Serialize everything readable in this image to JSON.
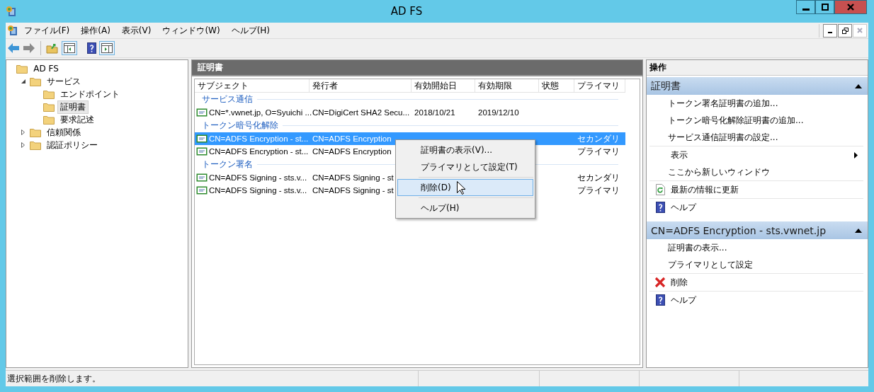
{
  "window": {
    "title": "AD FS"
  },
  "menu": [
    {
      "label": "ファイル(F)"
    },
    {
      "label": "操作(A)"
    },
    {
      "label": "表示(V)"
    },
    {
      "label": "ウィンドウ(W)"
    },
    {
      "label": "ヘルプ(H)"
    }
  ],
  "tree": [
    {
      "label": "AD FS",
      "selected": false,
      "children": [
        {
          "label": "サービス",
          "selected": false,
          "expanded": true,
          "children": [
            {
              "label": "エンドポイント",
              "selected": false
            },
            {
              "label": "証明書",
              "selected": true
            },
            {
              "label": "要求記述",
              "selected": false
            }
          ]
        },
        {
          "label": "信頼関係",
          "selected": false,
          "expanded": false
        },
        {
          "label": "認証ポリシー",
          "selected": false,
          "expanded": false
        }
      ]
    }
  ],
  "list": {
    "title": "証明書",
    "columns": [
      "サブジェクト",
      "発行者",
      "有効開始日",
      "有効期限",
      "状態",
      "プライマリ"
    ],
    "groups": [
      {
        "label": "サービス通信",
        "rows": [
          {
            "subject": "CN=*.vwnet.jp, O=Syuichi ...",
            "issuer": "CN=DigiCert SHA2 Secu...",
            "valid_from": "2018/10/21",
            "valid_to": "2019/12/10",
            "selected": false
          }
        ]
      },
      {
        "label": "トークン暗号化解除",
        "rows": [
          {
            "subject": "CN=ADFS Encryption - st...",
            "issuer": "CN=ADFS Encryption",
            "primary": "セカンダリ",
            "selected": true
          },
          {
            "subject": "CN=ADFS Encryption - st...",
            "issuer": "CN=ADFS Encryption",
            "primary": "プライマリ",
            "selected": false
          }
        ]
      },
      {
        "label": "トークン署名",
        "rows": [
          {
            "subject": "CN=ADFS Signing - sts.v...",
            "issuer": "CN=ADFS Signing - st",
            "primary": "セカンダリ",
            "selected": false
          },
          {
            "subject": "CN=ADFS Signing - sts.v...",
            "issuer": "CN=ADFS Signing - st",
            "primary": "プライマリ",
            "selected": false
          }
        ]
      }
    ]
  },
  "context_menu": {
    "items": [
      {
        "kind": "item",
        "label": "証明書の表示(V)...",
        "selected": false
      },
      {
        "kind": "item",
        "label": "プライマリとして設定(T)",
        "selected": false
      },
      {
        "kind": "separator"
      },
      {
        "kind": "item",
        "label": "削除(D)",
        "selected": true
      },
      {
        "kind": "separator"
      },
      {
        "kind": "item",
        "label": "ヘルプ(H)",
        "selected": false
      }
    ]
  },
  "actions": {
    "title": "操作",
    "sections": [
      {
        "title": "証明書",
        "expanded": true,
        "items": [
          {
            "kind": "plain",
            "label": "トークン署名証明書の追加...",
            "separator_before": false
          },
          {
            "kind": "plain",
            "label": "トークン暗号化解除証明書の追加...",
            "separator_before": false
          },
          {
            "kind": "plain",
            "label": "サービス通信証明書の設定...",
            "separator_before": false
          },
          {
            "kind": "submenu",
            "label": "表示",
            "separator_before": true
          },
          {
            "kind": "plain",
            "label": "ここから新しいウィンドウ",
            "separator_before": false
          },
          {
            "kind": "refresh",
            "label": "最新の情報に更新",
            "separator_before": true
          },
          {
            "kind": "help",
            "label": "ヘルプ",
            "separator_before": true
          }
        ]
      },
      {
        "title": "CN=ADFS Encryption - sts.vwnet.jp",
        "expanded": true,
        "items": [
          {
            "kind": "plain",
            "label": "証明書の表示...",
            "separator_before": false
          },
          {
            "kind": "plain",
            "label": "プライマリとして設定",
            "separator_before": false
          },
          {
            "kind": "delete",
            "label": "削除",
            "separator_before": true
          },
          {
            "kind": "help",
            "label": "ヘルプ",
            "separator_before": true
          }
        ]
      }
    ]
  },
  "status_bar": {
    "text": "選択範囲を削除します。"
  }
}
